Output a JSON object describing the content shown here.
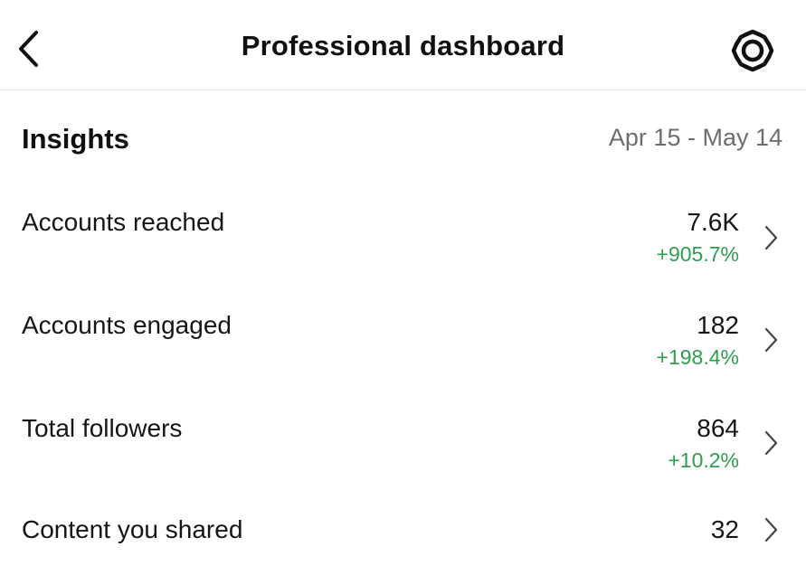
{
  "header": {
    "title": "Professional dashboard",
    "back_icon": "chevron-left-icon",
    "settings_icon": "gear-icon"
  },
  "insights": {
    "heading": "Insights",
    "date_range": "Apr 15 - May 14",
    "rows": [
      {
        "label": "Accounts reached",
        "value": "7.6K",
        "change": "+905.7%"
      },
      {
        "label": "Accounts engaged",
        "value": "182",
        "change": "+198.4%"
      },
      {
        "label": "Total followers",
        "value": "864",
        "change": "+10.2%"
      },
      {
        "label": "Content you shared",
        "value": "32",
        "change": ""
      }
    ]
  },
  "colors": {
    "positive_change": "#2e9e4f",
    "muted_text": "#6e6e6e"
  }
}
